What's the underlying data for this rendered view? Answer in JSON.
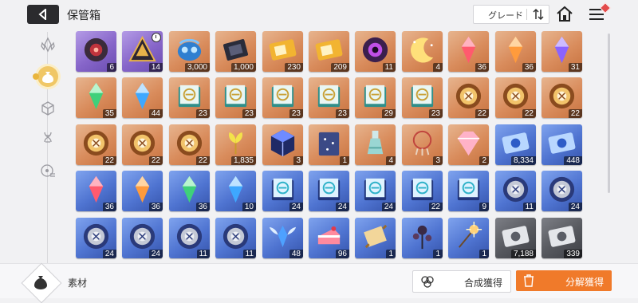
{
  "header": {
    "title": "保管箱",
    "grade_label": "グレード"
  },
  "sidebar": {
    "items": [
      {
        "name": "crystal-category",
        "icon": "crystal-icon",
        "active": false
      },
      {
        "name": "materials-category",
        "icon": "pouch-icon",
        "active": true
      },
      {
        "name": "cube-category",
        "icon": "cube-icon",
        "active": false
      },
      {
        "name": "dna-category",
        "icon": "dna-icon",
        "active": false
      },
      {
        "name": "disc-category",
        "icon": "disc-icon",
        "active": false
      }
    ]
  },
  "inventory": {
    "rows": [
      [
        {
          "bg": "purple",
          "icon": "dark-core-icon",
          "qty": "6"
        },
        {
          "bg": "purple",
          "icon": "pyramid-icon",
          "qty": "14",
          "timer": true
        },
        {
          "bg": "gold",
          "icon": "blue-mask-icon",
          "qty": "3,000"
        },
        {
          "bg": "gold",
          "icon": "chip-icon",
          "qty": "1,000"
        },
        {
          "bg": "gold",
          "icon": "gold-ticket-icon",
          "qty": "230"
        },
        {
          "bg": "gold",
          "icon": "gold-ticket-icon",
          "qty": "209"
        },
        {
          "bg": "gold",
          "icon": "purple-eye-icon",
          "qty": "11"
        },
        {
          "bg": "gold",
          "icon": "moon-icon",
          "qty": "4"
        },
        {
          "bg": "gold",
          "icon": "red-crystal-icon",
          "qty": "36"
        },
        {
          "bg": "gold",
          "icon": "orange-crystal-icon",
          "qty": "36"
        },
        {
          "bg": "gold",
          "icon": "violet-crystal-icon",
          "qty": "31"
        }
      ],
      [
        {
          "bg": "gold",
          "icon": "green-crystal-icon",
          "qty": "35"
        },
        {
          "bg": "gold",
          "icon": "blue-crystal-icon",
          "qty": "44"
        },
        {
          "bg": "gold",
          "icon": "gold-book-icon",
          "qty": "23"
        },
        {
          "bg": "gold",
          "icon": "gold-book-icon",
          "qty": "23"
        },
        {
          "bg": "gold",
          "icon": "gold-book-icon",
          "qty": "23"
        },
        {
          "bg": "gold",
          "icon": "gold-book-icon",
          "qty": "23"
        },
        {
          "bg": "gold",
          "icon": "gold-book-icon",
          "qty": "29"
        },
        {
          "bg": "gold",
          "icon": "gold-book-icon",
          "qty": "23"
        },
        {
          "bg": "gold",
          "icon": "gear-medal-icon",
          "qty": "22"
        },
        {
          "bg": "gold",
          "icon": "gear-medal-icon",
          "qty": "22"
        },
        {
          "bg": "gold",
          "icon": "gear-medal-icon",
          "qty": "22"
        }
      ],
      [
        {
          "bg": "gold",
          "icon": "gear-medal-icon",
          "qty": "22"
        },
        {
          "bg": "gold",
          "icon": "gear-medal-icon",
          "qty": "22"
        },
        {
          "bg": "gold",
          "icon": "gear-medal-icon",
          "qty": "22"
        },
        {
          "bg": "gold",
          "icon": "sprout-icon",
          "qty": "1,835"
        },
        {
          "bg": "gold",
          "icon": "dark-cube-icon",
          "qty": "3"
        },
        {
          "bg": "gold",
          "icon": "star-book-icon",
          "qty": "1"
        },
        {
          "bg": "gold",
          "icon": "potion-icon",
          "qty": "4"
        },
        {
          "bg": "gold",
          "icon": "dreamcatcher-icon",
          "qty": "3"
        },
        {
          "bg": "gold",
          "icon": "pink-gem-icon",
          "qty": "2"
        },
        {
          "bg": "blue",
          "icon": "blue-ticket-icon",
          "qty": "8,334"
        },
        {
          "bg": "blue",
          "icon": "blue-ticket-icon",
          "qty": "448"
        }
      ],
      [
        {
          "bg": "blue",
          "icon": "red-crystal-icon",
          "qty": "36"
        },
        {
          "bg": "blue",
          "icon": "orange-crystal-icon",
          "qty": "36"
        },
        {
          "bg": "blue",
          "icon": "green-crystal-icon",
          "qty": "36"
        },
        {
          "bg": "blue",
          "icon": "blue-crystal-icon",
          "qty": "10"
        },
        {
          "bg": "blue",
          "icon": "blue-book-icon",
          "qty": "24"
        },
        {
          "bg": "blue",
          "icon": "blue-book-icon",
          "qty": "24"
        },
        {
          "bg": "blue",
          "icon": "blue-book-icon",
          "qty": "24"
        },
        {
          "bg": "blue",
          "icon": "blue-book-icon",
          "qty": "22"
        },
        {
          "bg": "blue",
          "icon": "blue-book-icon",
          "qty": "9"
        },
        {
          "bg": "blue",
          "icon": "blue-medal-icon",
          "qty": "11"
        },
        {
          "bg": "blue",
          "icon": "blue-medal-icon",
          "qty": "24"
        }
      ],
      [
        {
          "bg": "blue",
          "icon": "blue-medal-icon",
          "qty": "24"
        },
        {
          "bg": "blue",
          "icon": "blue-medal-icon",
          "qty": "24"
        },
        {
          "bg": "blue",
          "icon": "blue-medal-icon",
          "qty": "11"
        },
        {
          "bg": "blue",
          "icon": "blue-medal-icon",
          "qty": "11"
        },
        {
          "bg": "blue",
          "icon": "wing-crystal-icon",
          "qty": "48"
        },
        {
          "bg": "blue",
          "icon": "cake-icon",
          "qty": "96"
        },
        {
          "bg": "blue",
          "icon": "scroll-icon",
          "qty": "1"
        },
        {
          "bg": "blue",
          "icon": "flower-icon",
          "qty": "1"
        },
        {
          "bg": "blue",
          "icon": "sparkler-icon",
          "qty": "1"
        },
        {
          "bg": "grey",
          "icon": "grey-ticket-icon",
          "qty": "7,188"
        },
        {
          "bg": "grey",
          "icon": "grey-ticket-icon",
          "qty": "339"
        }
      ]
    ]
  },
  "footer": {
    "category_label": "素材",
    "compose_label": "合成獲得",
    "decompose_label": "分解獲得"
  },
  "colors": {
    "accent_orange": "#f07a2a",
    "active_tab": "#f0c766"
  }
}
